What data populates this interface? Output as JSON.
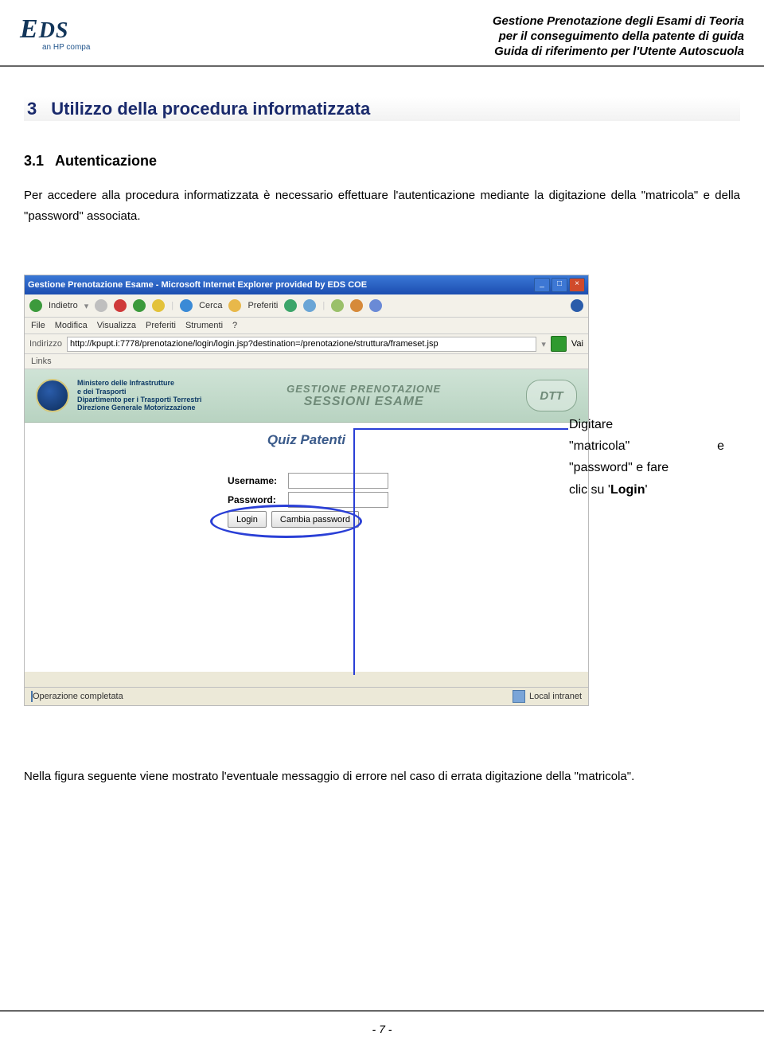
{
  "header": {
    "logo_main": "EDS",
    "logo_sub": "an HP compa",
    "lines": [
      "Gestione Prenotazione degli Esami di Teoria",
      "per il conseguimento della patente di guida",
      "Guida di riferimento per l'Utente Autoscuola"
    ]
  },
  "section": {
    "num": "3",
    "title": "Utilizzo della procedura informatizzata"
  },
  "subsection": {
    "num": "3.1",
    "title": "Autenticazione"
  },
  "paragraph1": "Per accedere alla procedura informatizzata è necessario effettuare l'autenticazione mediante la digitazione della \"matricola\" e della \"password\" associata.",
  "screenshot": {
    "window_title": "Gestione Prenotazione Esame - Microsoft Internet Explorer provided by EDS COE",
    "toolbar": {
      "back": "Indietro",
      "search": "Cerca",
      "favorites": "Preferiti"
    },
    "menu": [
      "File",
      "Modifica",
      "Visualizza",
      "Preferiti",
      "Strumenti",
      "?"
    ],
    "address_label": "Indirizzo",
    "url": "http://kpupt.i:7778/prenotazione/login/login.jsp?destination=/prenotazione/struttura/frameset.jsp",
    "go_label": "Vai",
    "links_label": "Links",
    "ministero_lines": [
      "Ministero delle Infrastrutture",
      "e dei Trasporti",
      "Dipartimento per i Trasporti Terrestri",
      "Direzione Generale Motorizzazione"
    ],
    "brand_line1": "GESTIONE PRENOTAZIONE",
    "brand_line2": "SESSIONI ESAME",
    "dtt": "DTT",
    "quiz_title": "Quiz Patenti",
    "username_label": "Username:",
    "password_label": "Password:",
    "login_button": "Login",
    "change_pwd_button": "Cambia password",
    "status_left": "Operazione completata",
    "status_right": "Local intranet"
  },
  "callout": {
    "line1_a": "Digitare",
    "line2_a": "\"matricola\"",
    "line2_b": "e",
    "line3_a": "\"password\" e fare",
    "line4_a": "clic su '",
    "line4_bold": "Login",
    "line4_b": "'"
  },
  "paragraph2": "Nella figura seguente viene mostrato l'eventuale messaggio di errore nel caso di errata digitazione della \"matricola\".",
  "footer": {
    "page": "- 7 -"
  }
}
